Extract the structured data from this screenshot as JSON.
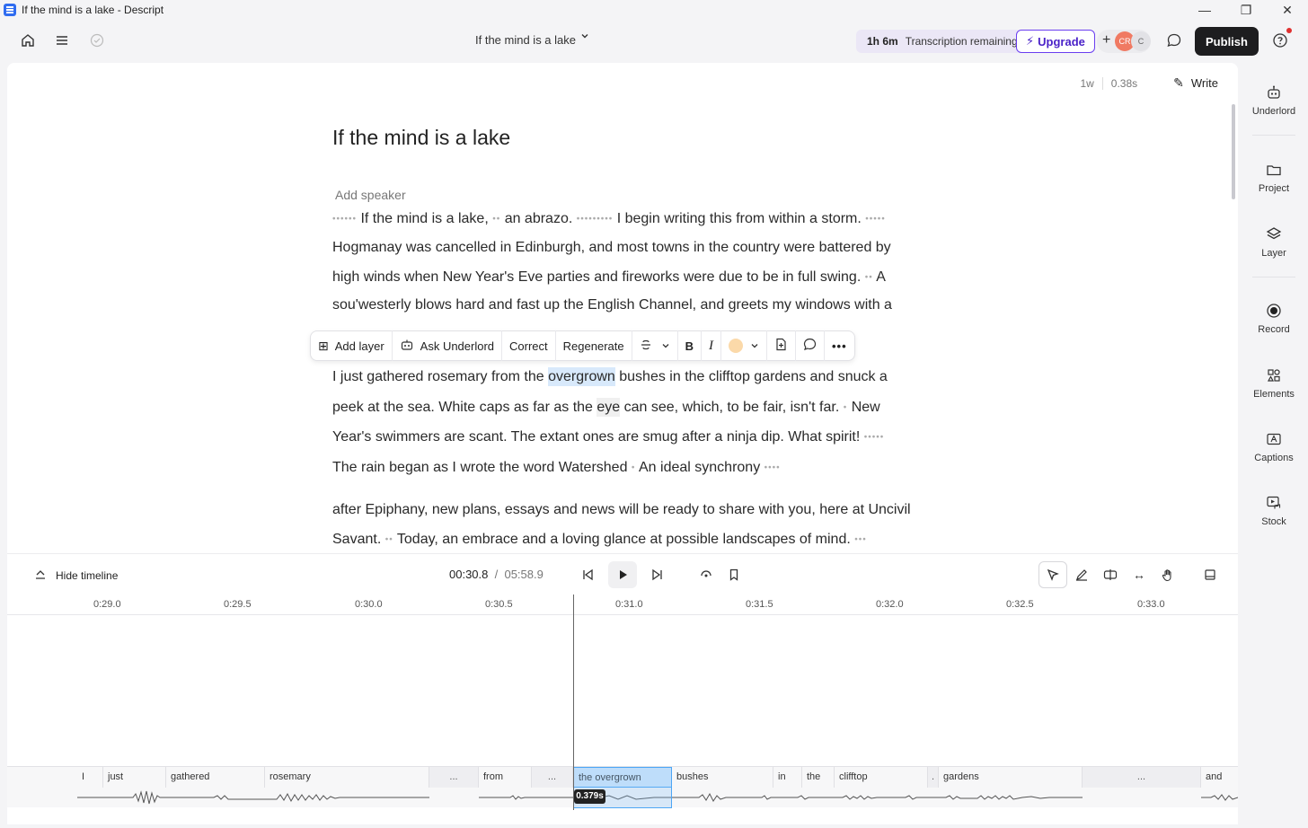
{
  "window": {
    "title": "If the mind is a lake - Descript",
    "controls": [
      "—",
      "❐",
      "✕"
    ]
  },
  "toolbar": {
    "doc_title": "If the mind is a lake",
    "transcription_time": "1h 6m",
    "transcription_label": "Transcription remaining",
    "upgrade_label": "Upgrade",
    "avatar_1": "CR",
    "avatar_2": "C",
    "publish_label": "Publish"
  },
  "editor": {
    "word_count": "1w",
    "duration": "0.38s",
    "write_label": "Write",
    "heading": "If the mind is a lake",
    "add_speaker": "Add speaker",
    "lines": {
      "l1_a": "If the mind is a lake,",
      "l1_b": "an abrazo.",
      "l1_c": "I begin writing this from within a storm.",
      "l2": "Hogmanay was cancelled in Edinburgh, and most towns in the country were battered by",
      "l3_a": "high winds when New Year's Eve parties and fireworks were due to be in full swing.",
      "l3_b": "A",
      "l4": "sou'westerly blows hard and fast up the English Channel, and greets my windows with a",
      "l6_a": "I just gathered rosemary from the ",
      "l6_hl": "overgrown",
      "l6_b": " bushes in the clifftop gardens and snuck a",
      "l7_a": "peek at the sea. White caps as far as the ",
      "l7_hl": "eye",
      "l7_b": " can see, which, to be fair, isn't far.",
      "l7_c": "New",
      "l8": "Year's swimmers are scant. The extant ones are smug after a ninja dip. What spirit!",
      "l9_a": "The rain began as I wrote the word Watershed",
      "l9_b": "An ideal synchrony",
      "l10": "after Epiphany, new plans, essays and news will be ready to share with you, here at Uncivil",
      "l11_a": "Savant.",
      "l11_b": "Today, an embrace and a loving glance at possible landscapes of mind."
    }
  },
  "selection_toolbar": {
    "add_layer": "Add layer",
    "ask_underlord": "Ask Underlord",
    "correct": "Correct",
    "regenerate": "Regenerate",
    "bold": "B",
    "italic": "I",
    "highlight_color": "#fbd9a9"
  },
  "transport": {
    "hide_timeline": "Hide timeline",
    "current_time": "00:30.8",
    "separator": "/",
    "total_time": "05:58.9"
  },
  "ruler_ticks": [
    "0:29.0",
    "0:29.5",
    "0:30.0",
    "0:30.5",
    "0:31.0",
    "0:31.5",
    "0:32.0",
    "0:32.5",
    "0:33.0"
  ],
  "track": {
    "words": [
      "I",
      "just",
      "gathered",
      "rosemary",
      "...",
      "from",
      "...",
      "the overgrown",
      "bushes",
      "in",
      "the",
      "clifftop",
      ".",
      "gardens",
      "...",
      "and"
    ],
    "playhead_badge": "0.379s"
  },
  "right_panel": {
    "items": [
      "Underlord",
      "Project",
      "Layer",
      "Record",
      "Elements",
      "Captions",
      "Stock"
    ]
  },
  "colors": {
    "accent": "#6b3ef0",
    "selection": "#d8e9fb",
    "publish_bg": "#1d1d1f"
  }
}
